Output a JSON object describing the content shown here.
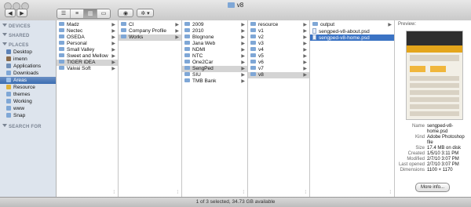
{
  "window": {
    "title": "v8"
  },
  "toolbar": {
    "nav_back": "◀",
    "nav_forward": "▶",
    "view_modes": [
      "☰",
      "≡",
      "▥",
      "▭"
    ],
    "quicklook": "◉",
    "action": "✲ ▾"
  },
  "sidebar": {
    "sections": [
      {
        "label": "DEVICES",
        "items": []
      },
      {
        "label": "SHARED",
        "items": []
      },
      {
        "label": "PLACES",
        "items": [
          {
            "label": "Desktop",
            "icon": "desktop-icon"
          },
          {
            "label": "imenn",
            "icon": "home-icon"
          },
          {
            "label": "Applications",
            "icon": "applications-icon"
          },
          {
            "label": "Downloads",
            "icon": "downloads-icon"
          },
          {
            "label": "Areas",
            "icon": "folder-icon",
            "selected": true
          },
          {
            "label": "Resource",
            "icon": "folder-icon"
          },
          {
            "label": "themes",
            "icon": "folder-icon"
          },
          {
            "label": "Working",
            "icon": "folder-icon"
          },
          {
            "label": "www",
            "icon": "folder-icon"
          },
          {
            "label": "Snap",
            "icon": "folder-icon"
          }
        ]
      },
      {
        "label": "SEARCH FOR",
        "items": []
      }
    ]
  },
  "columns": [
    {
      "items": [
        {
          "label": "Madz"
        },
        {
          "label": "Nectec"
        },
        {
          "label": "OSEDA"
        },
        {
          "label": "Personal"
        },
        {
          "label": "Small Valley"
        },
        {
          "label": "Sweet and Mellow"
        },
        {
          "label": "TIGER iDEA",
          "selected": true
        },
        {
          "label": "Vaivai Soft"
        }
      ]
    },
    {
      "items": [
        {
          "label": "CI"
        },
        {
          "label": "Company Profile"
        },
        {
          "label": "Works",
          "selected": true
        }
      ]
    },
    {
      "items": [
        {
          "label": "2009"
        },
        {
          "label": "2010"
        },
        {
          "label": "Blognone"
        },
        {
          "label": "Jana Web"
        },
        {
          "label": "NDMI"
        },
        {
          "label": "NTC"
        },
        {
          "label": "One2Car"
        },
        {
          "label": "SengPed",
          "selected": true
        },
        {
          "label": "SIU"
        },
        {
          "label": "TMB Bank"
        }
      ]
    },
    {
      "items": [
        {
          "label": "resource"
        },
        {
          "label": "v1"
        },
        {
          "label": "v2"
        },
        {
          "label": "v3"
        },
        {
          "label": "v4"
        },
        {
          "label": "v5"
        },
        {
          "label": "v6"
        },
        {
          "label": "v7"
        },
        {
          "label": "v8",
          "selected": true
        }
      ]
    },
    {
      "items": [
        {
          "label": "output"
        },
        {
          "label": "sengped-v8-about.psd"
        },
        {
          "label": "sengped-v8-home.psd",
          "selected": true
        }
      ]
    }
  ],
  "preview": {
    "label": "Preview:",
    "meta": [
      {
        "k": "Name",
        "v": "sengped-v8-home.psd"
      },
      {
        "k": "Kind",
        "v": "Adobe Photoshop file"
      },
      {
        "k": "Size",
        "v": "17.4 MB on disk"
      },
      {
        "k": "Created",
        "v": "1/5/10 3:11 PM"
      },
      {
        "k": "Modified",
        "v": "2/7/10 3:07 PM"
      },
      {
        "k": "Last opened",
        "v": "2/7/10 3:07 PM"
      },
      {
        "k": "Dimensions",
        "v": "1100 × 1170"
      }
    ],
    "more_info": "More info..."
  },
  "status": "1 of 3 selected, 34.73 GB available",
  "colors": {
    "selection": "#3b73c4",
    "sidebar_bg": "#dde4ed",
    "folder": "#7fa7d6"
  }
}
